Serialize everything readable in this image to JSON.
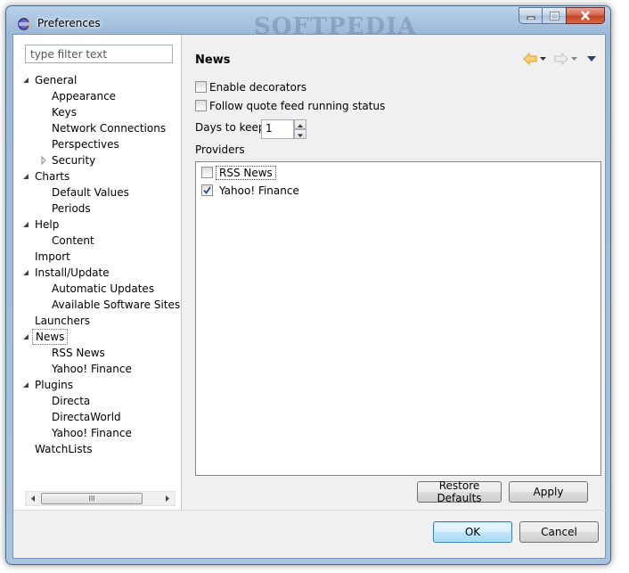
{
  "window": {
    "title": "Preferences",
    "watermark": "SOFTPEDIA"
  },
  "filter": {
    "placeholder": "type filter text"
  },
  "tree": [
    {
      "label": "General",
      "level": 0,
      "twisty": "expanded"
    },
    {
      "label": "Appearance",
      "level": 1,
      "twisty": "none"
    },
    {
      "label": "Keys",
      "level": 1,
      "twisty": "none"
    },
    {
      "label": "Network Connections",
      "level": 1,
      "twisty": "none"
    },
    {
      "label": "Perspectives",
      "level": 1,
      "twisty": "none"
    },
    {
      "label": "Security",
      "level": 1,
      "twisty": "collapsed"
    },
    {
      "label": "Charts",
      "level": 0,
      "twisty": "expanded"
    },
    {
      "label": "Default Values",
      "level": 1,
      "twisty": "none"
    },
    {
      "label": "Periods",
      "level": 1,
      "twisty": "none"
    },
    {
      "label": "Help",
      "level": 0,
      "twisty": "expanded"
    },
    {
      "label": "Content",
      "level": 1,
      "twisty": "none"
    },
    {
      "label": "Import",
      "level": 0,
      "twisty": "none"
    },
    {
      "label": "Install/Update",
      "level": 0,
      "twisty": "expanded"
    },
    {
      "label": "Automatic Updates",
      "level": 1,
      "twisty": "none"
    },
    {
      "label": "Available Software Sites",
      "level": 1,
      "twisty": "none"
    },
    {
      "label": "Launchers",
      "level": 0,
      "twisty": "none"
    },
    {
      "label": "News",
      "level": 0,
      "twisty": "expanded",
      "selected": true
    },
    {
      "label": "RSS News",
      "level": 1,
      "twisty": "none"
    },
    {
      "label": "Yahoo! Finance",
      "level": 1,
      "twisty": "none"
    },
    {
      "label": "Plugins",
      "level": 0,
      "twisty": "expanded"
    },
    {
      "label": "Directa",
      "level": 1,
      "twisty": "none"
    },
    {
      "label": "DirectaWorld",
      "level": 1,
      "twisty": "none"
    },
    {
      "label": "Yahoo! Finance",
      "level": 1,
      "twisty": "none"
    },
    {
      "label": "WatchLists",
      "level": 0,
      "twisty": "none"
    }
  ],
  "scrollbar": {
    "thumb_grip": "III"
  },
  "page": {
    "title": "News",
    "enable_decorators": {
      "label": "Enable decorators",
      "checked": false
    },
    "follow_quote": {
      "label": "Follow quote feed running status",
      "checked": false
    },
    "days_to_keep": {
      "label": "Days to keep",
      "value": "1"
    },
    "providers_label": "Providers",
    "providers": [
      {
        "label": "RSS News",
        "checked": false,
        "focused": true
      },
      {
        "label": "Yahoo! Finance",
        "checked": true,
        "focused": false
      }
    ],
    "restore_defaults": "Restore Defaults",
    "apply": "Apply"
  },
  "dialog": {
    "ok": "OK",
    "cancel": "Cancel"
  },
  "colors": {
    "nav_back": "#e6a83a",
    "nav_forward": "#c9c9c9",
    "check": "#2a4d8f"
  }
}
